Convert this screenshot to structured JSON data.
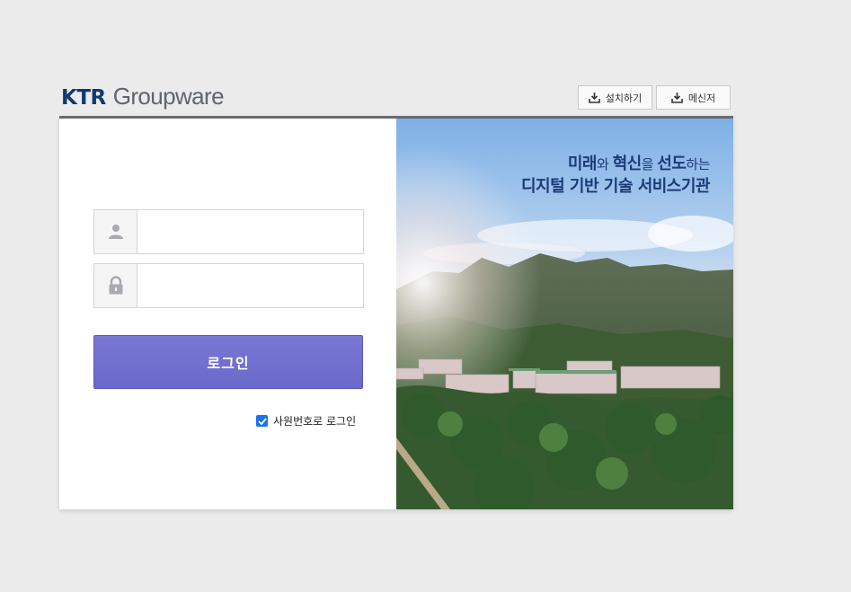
{
  "header": {
    "logo_brand": "KTR",
    "logo_product": "Groupware",
    "install_label": "설치하기",
    "messenger_label": "메신저"
  },
  "login": {
    "id_placeholder": "",
    "pw_placeholder": "",
    "login_label": "로그인",
    "employee_number_label": "사원번호로 로그인",
    "employee_number_checked": true
  },
  "hero": {
    "line1_a": "미래",
    "line1_b": "와 ",
    "line1_c": "혁신",
    "line1_d": "을 ",
    "line1_e": "선도",
    "line1_f": "하는",
    "line2": "디지털  기반 기술 서비스기관"
  },
  "icons": {
    "user": "user-icon",
    "lock": "lock-icon",
    "download": "download-icon",
    "checkbox": "checkbox-checked-icon"
  },
  "colors": {
    "brand_navy": "#13396f",
    "login_button": "#6f6dcf",
    "checkbox": "#1a73e8",
    "background": "#ebebeb"
  }
}
